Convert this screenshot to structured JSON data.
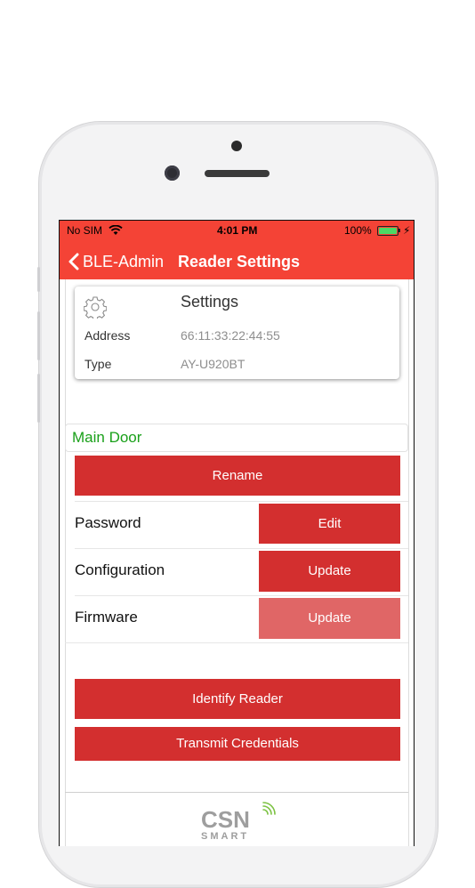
{
  "status_bar": {
    "carrier": "No SIM",
    "time": "4:01 PM",
    "battery": "100%"
  },
  "nav": {
    "back_label": "BLE-Admin",
    "title": "Reader Settings"
  },
  "settings_card": {
    "title": "Settings",
    "address_label": "Address",
    "address_value": "66:11:33:22:44:55",
    "type_label": "Type",
    "type_value": "AY-U920BT"
  },
  "reader_name": "Main Door",
  "buttons": {
    "rename": "Rename",
    "identify": "Identify Reader",
    "transmit": "Transmit Credentials"
  },
  "rows": [
    {
      "label": "Password",
      "action": "Edit"
    },
    {
      "label": "Configuration",
      "action": "Update"
    },
    {
      "label": "Firmware",
      "action": "Update"
    }
  ],
  "logo": {
    "line1": "CSN",
    "line2": "SMART"
  },
  "colors": {
    "header": "#f44336",
    "button": "#d32f2f",
    "button_disabled": "#e06666",
    "reader_name": "#1aa01a"
  }
}
